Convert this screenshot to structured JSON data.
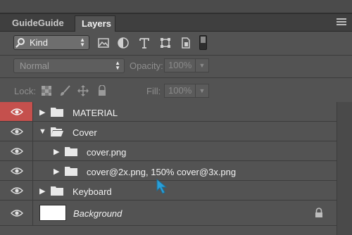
{
  "tabs": [
    {
      "label": "GuideGuide",
      "active": false
    },
    {
      "label": "Layers",
      "active": true
    }
  ],
  "filter": {
    "kind_label": "Kind",
    "icons": [
      "image-filter-icon",
      "adjustment-filter-icon",
      "type-filter-icon",
      "shape-filter-icon",
      "smart-object-filter-icon"
    ]
  },
  "blend": {
    "mode": "Normal",
    "opacity_label": "Opacity:",
    "opacity_value": "100%",
    "fill_label": "Fill:",
    "fill_value": "100%"
  },
  "lock": {
    "label": "Lock:",
    "icons": [
      "lock-transparency-icon",
      "lock-paint-icon",
      "lock-position-icon",
      "lock-all-icon"
    ]
  },
  "layers": [
    {
      "name": "MATERIAL",
      "type": "group",
      "expanded": false,
      "eye_highlight": true
    },
    {
      "name": "Cover",
      "type": "group",
      "expanded": true,
      "eye_highlight": false
    },
    {
      "name": "cover.png",
      "type": "group",
      "expanded": false,
      "eye_highlight": false
    },
    {
      "name": "cover@2x.png, 150% cover@3x.png",
      "type": "group",
      "expanded": false,
      "eye_highlight": false
    },
    {
      "name": "Keyboard",
      "type": "group",
      "expanded": false,
      "eye_highlight": false
    },
    {
      "name": "Background",
      "type": "background",
      "locked": true,
      "eye_highlight": false
    }
  ],
  "colors": {
    "panel_bg": "#535353",
    "eye_highlight": "#c5504d",
    "cursor": "#2a9fd8"
  }
}
